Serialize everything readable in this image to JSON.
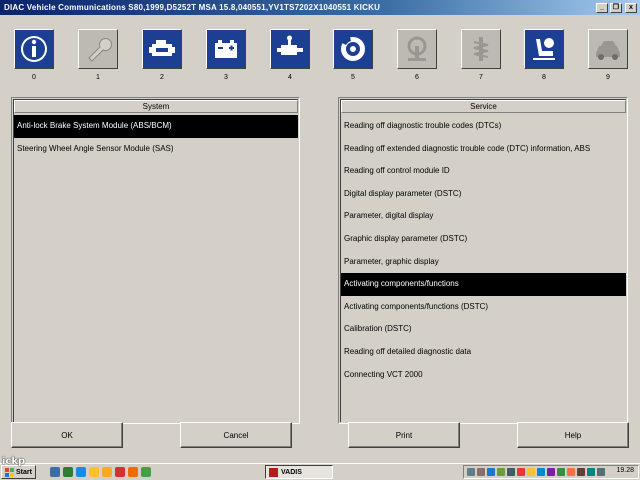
{
  "window": {
    "title": "DIAC  Vehicle Communications S80,1999,D5252T MSA 15.8,040551,YV1TS7202X1040551 KICKU",
    "minimize_glyph": "_",
    "restore_glyph": "❐",
    "close_glyph": "x"
  },
  "toolbar": [
    {
      "num": "0",
      "icon": "info-icon",
      "active": true
    },
    {
      "num": "1",
      "icon": "wrench-icon",
      "active": false
    },
    {
      "num": "2",
      "icon": "engine-icon",
      "active": true
    },
    {
      "num": "3",
      "icon": "battery-icon",
      "active": true
    },
    {
      "num": "4",
      "icon": "transmission-icon",
      "active": true
    },
    {
      "num": "5",
      "icon": "brake-disc-icon",
      "active": true
    },
    {
      "num": "6",
      "icon": "steering-icon",
      "active": false
    },
    {
      "num": "7",
      "icon": "suspension-icon",
      "active": false
    },
    {
      "num": "8",
      "icon": "seat-airbag-icon",
      "active": true
    },
    {
      "num": "9",
      "icon": "car-body-icon",
      "active": false
    }
  ],
  "system_list": {
    "header": "System",
    "items": [
      "Anti-lock Brake System Module (ABS/BCM)",
      "Steering Wheel Angle Sensor Module (SAS)"
    ],
    "selected_index": 0
  },
  "service_list": {
    "header": "Service",
    "items": [
      "Reading off diagnostic trouble codes (DTCs)",
      "Reading off extended diagnostic trouble code (DTC) information, ABS",
      "Reading off control module ID",
      "Digital display parameter (DSTC)",
      "Parameter, digital display",
      "Graphic display parameter (DSTC)",
      "Parameter, graphic display",
      "Activating components/functions",
      "Activating components/functions (DSTC)",
      "Calibration (DSTC)",
      "Reading off detailed diagnostic data",
      "Connecting VCT 2000"
    ],
    "selected_index": 7
  },
  "buttons": {
    "ok": "OK",
    "cancel": "Cancel",
    "print": "Print",
    "help": "Help"
  },
  "taskbar": {
    "start": "Start",
    "task": "VADIS",
    "clock": "19.28"
  },
  "watermark": "ickp",
  "colors": {
    "title_start": "#0a246a",
    "title_end": "#a6caf0",
    "face": "#d4d0c8",
    "selection": "#000000",
    "icon_active": "#1c3f94"
  }
}
